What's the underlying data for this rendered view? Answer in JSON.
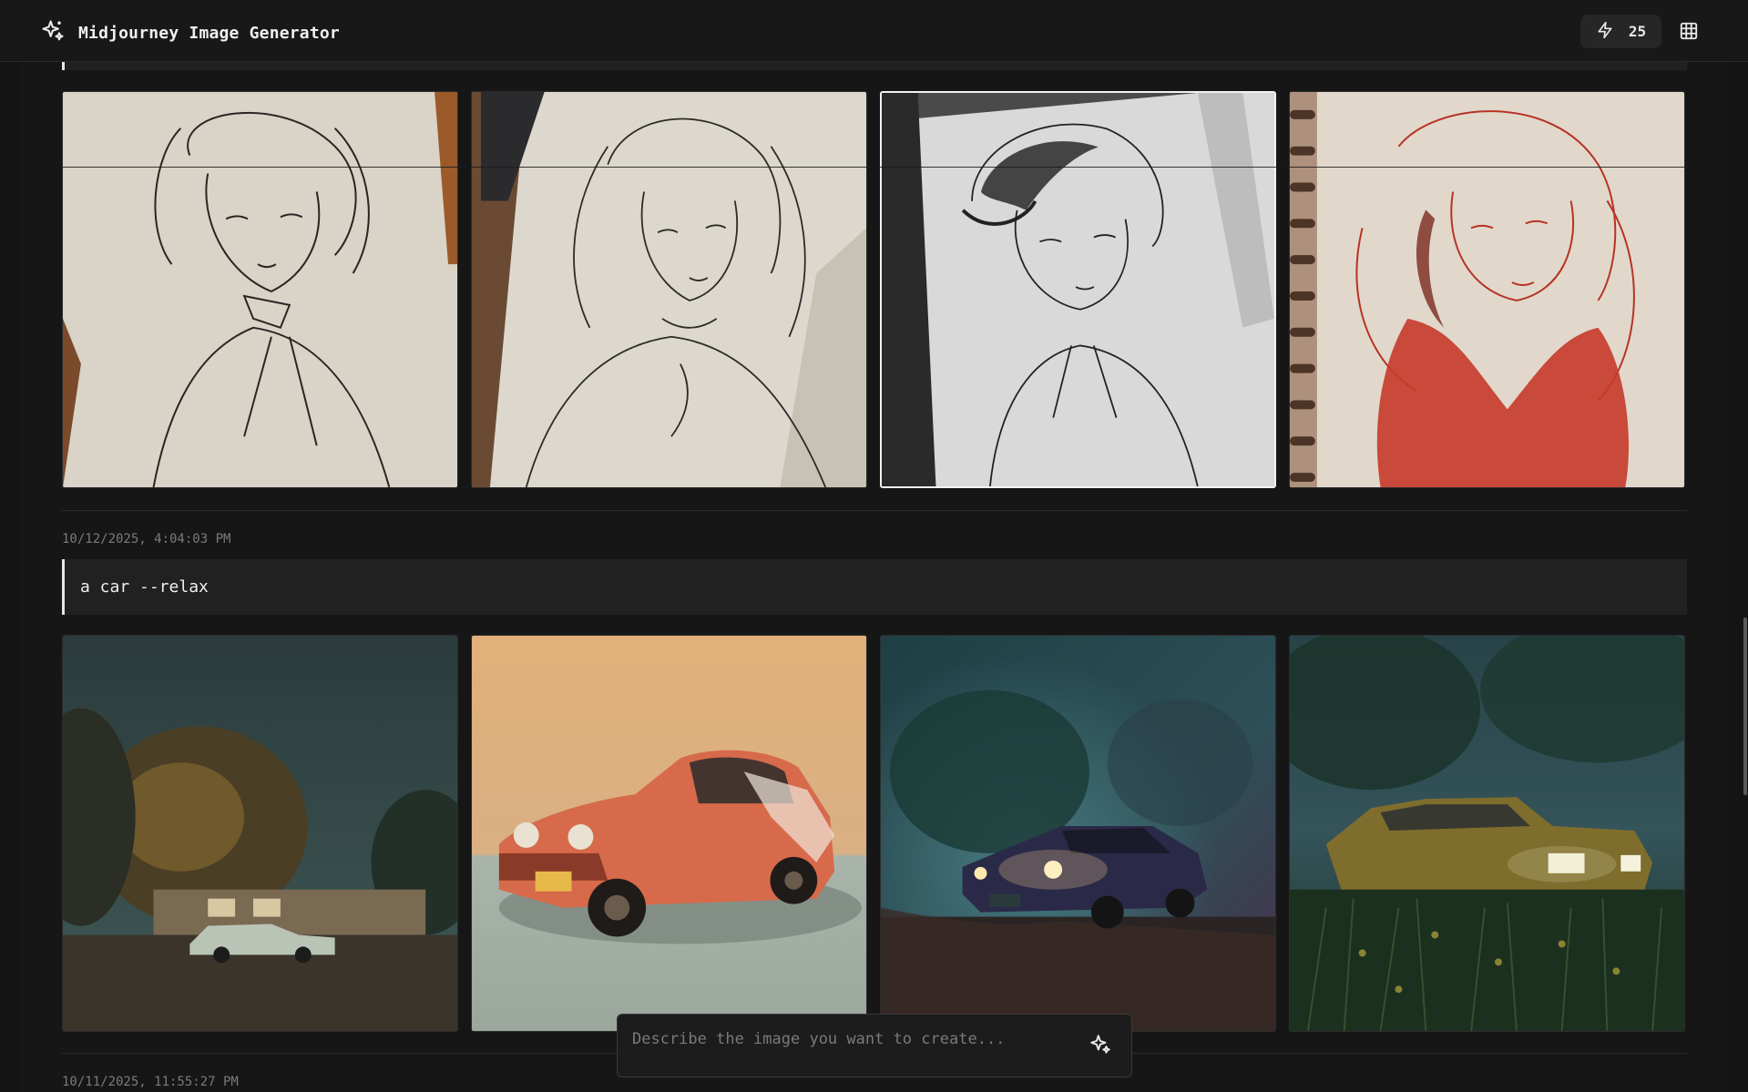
{
  "app": {
    "title": "Midjourney Image Generator",
    "credits": "25",
    "icons": {
      "logo": "sparkles-icon",
      "credits": "lightning-icon",
      "gallery": "grid-icon",
      "generate": "sparkles-icon"
    }
  },
  "generations": [
    {
      "images": [
        "sketch-portrait-ink",
        "sketch-portrait-pencil",
        "sketch-portrait-bw-notebook",
        "sketch-portrait-red"
      ],
      "selected_index": 2
    },
    {
      "timestamp": "10/12/2025, 4:04:03 PM",
      "prompt": "a car --relax",
      "images": [
        "car-night-house",
        "car-orange-studio",
        "car-fog-headlights",
        "car-forest-yellow"
      ]
    },
    {
      "timestamp": "10/11/2025, 11:55:27 PM"
    }
  ],
  "input": {
    "placeholder": "Describe the image you want to create..."
  },
  "colors": {
    "background": "#141414",
    "surface": "#212121",
    "accent": "#e6e6e6",
    "muted": "#7b7b7b",
    "sketch_red": "#c63a2a"
  }
}
